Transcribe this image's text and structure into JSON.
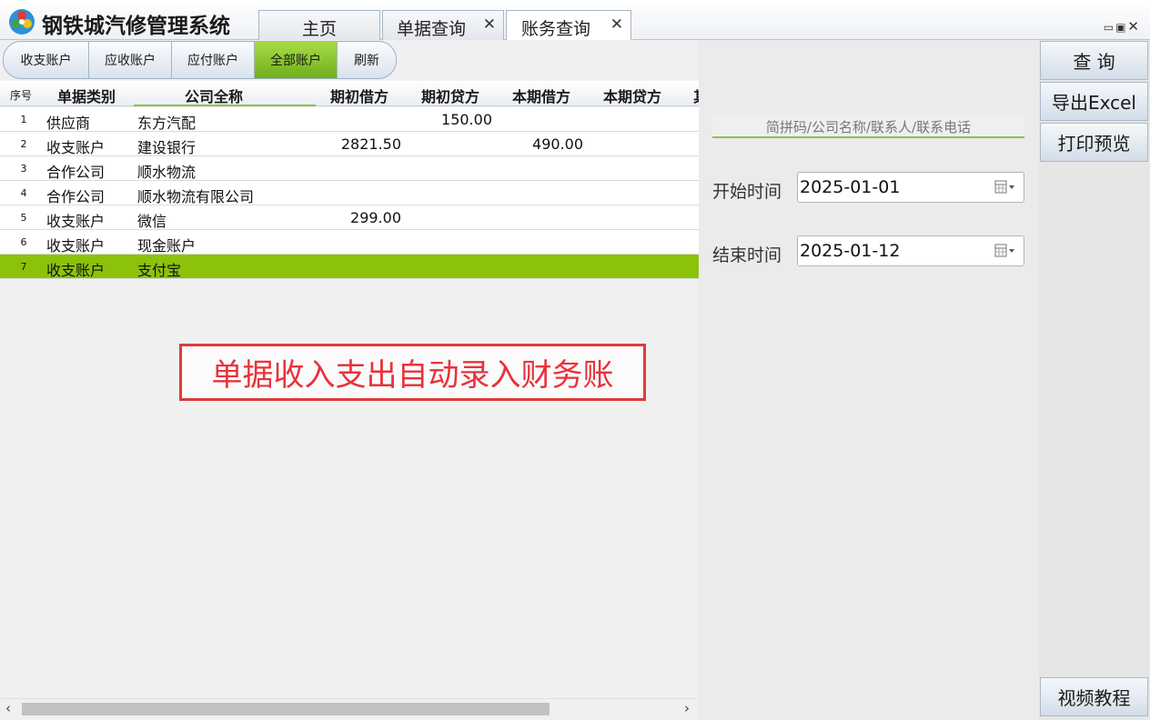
{
  "app": {
    "title": "钢铁城汽修管理系统"
  },
  "tabs": [
    {
      "label": "主页",
      "closable": false
    },
    {
      "label": "单据查询",
      "closable": true
    },
    {
      "label": "账务查询",
      "closable": true,
      "active": true
    }
  ],
  "window_controls": {
    "close": "✕"
  },
  "account_filters": {
    "buttons": [
      "收支账户",
      "应收账户",
      "应付账户",
      "全部账户",
      "刷新"
    ],
    "selected": "全部账户"
  },
  "table": {
    "columns": [
      "序号",
      "单据类别",
      "公司全称",
      "期初借方",
      "期初贷方",
      "本期借方",
      "本期贷方",
      "其"
    ],
    "rows": [
      {
        "no": "1",
        "type": "供应商",
        "name": "东方汽配",
        "open_debit": "",
        "open_credit": "150.00",
        "cur_debit": "",
        "cur_credit": ""
      },
      {
        "no": "2",
        "type": "收支账户",
        "name": "建设银行",
        "open_debit": "2821.50",
        "open_credit": "",
        "cur_debit": "490.00",
        "cur_credit": ""
      },
      {
        "no": "3",
        "type": "合作公司",
        "name": "顺水物流",
        "open_debit": "",
        "open_credit": "",
        "cur_debit": "",
        "cur_credit": ""
      },
      {
        "no": "4",
        "type": "合作公司",
        "name": "顺水物流有限公司",
        "open_debit": "",
        "open_credit": "",
        "cur_debit": "",
        "cur_credit": ""
      },
      {
        "no": "5",
        "type": "收支账户",
        "name": "微信",
        "open_debit": "299.00",
        "open_credit": "",
        "cur_debit": "",
        "cur_credit": ""
      },
      {
        "no": "6",
        "type": "收支账户",
        "name": "现金账户",
        "open_debit": "",
        "open_credit": "",
        "cur_debit": "",
        "cur_credit": ""
      },
      {
        "no": "7",
        "type": "收支账户",
        "name": "支付宝",
        "open_debit": "",
        "open_credit": "",
        "cur_debit": "",
        "cur_credit": "",
        "selected": true
      }
    ]
  },
  "annotation": "单据收入支出自动录入财务账",
  "filters": {
    "search_placeholder": "简拼码/公司名称/联系人/联系电话",
    "start_label": "开始时间",
    "start_value": "2025-01-01",
    "end_label": "结束时间",
    "end_value": "2025-01-12"
  },
  "actions": {
    "query": "查 询",
    "export": "导出Excel",
    "print": "打印预览",
    "video": "视频教程"
  },
  "colors": {
    "accent": "#8dc20a",
    "annotation": "#e8323b"
  }
}
